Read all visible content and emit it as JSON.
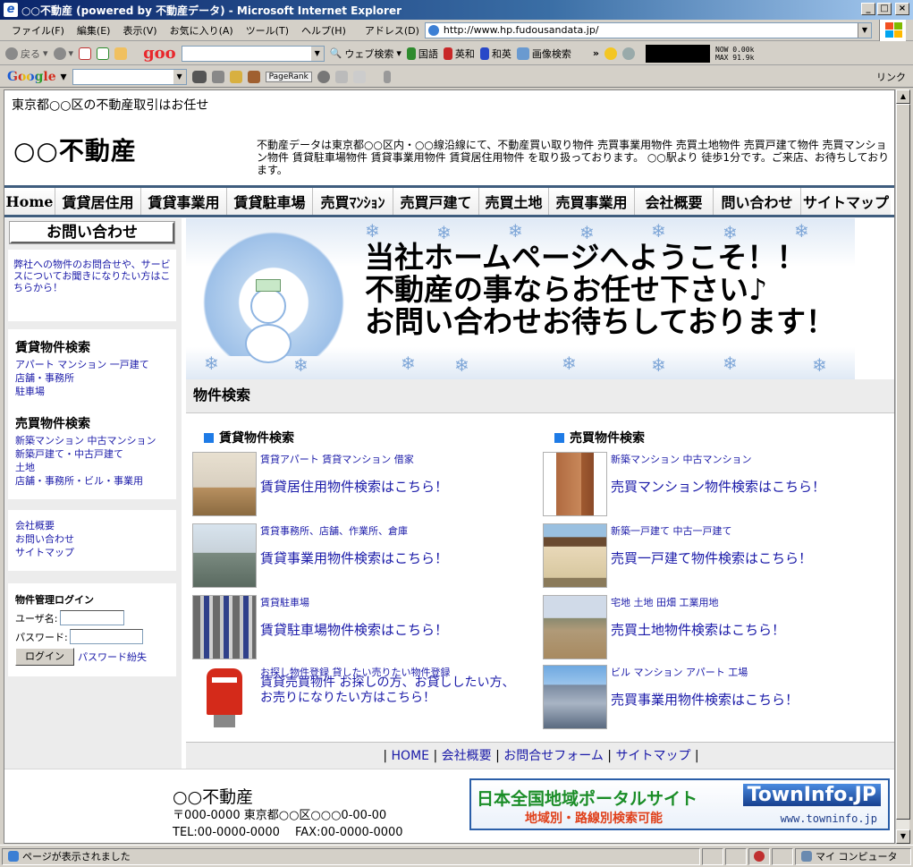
{
  "window": {
    "title": "○○不動産 (powered by 不動産データ) - Microsoft Internet Explorer",
    "minimize": "_",
    "maximize": "□",
    "close": "×"
  },
  "menubar": {
    "items": [
      "ファイル(F)",
      "編集(E)",
      "表示(V)",
      "お気に入り(A)",
      "ツール(T)",
      "ヘルプ(H)"
    ],
    "address_label": "アドレス(D)",
    "address_value": "http://www.hp.fudousandata.jp/"
  },
  "toolbar": {
    "back": "戻る",
    "goo": "goo",
    "web_search": "ウェブ検索",
    "kokugo": "国語",
    "eiwa": "英和",
    "waei": "和英",
    "image_search": "画像検索",
    "now": "NOW",
    "now_val": "0.00k",
    "max": "MAX",
    "max_val": "91.9k"
  },
  "googlebar": {
    "logo": "Google",
    "pagerank": "PageRank",
    "links_label": "リンク"
  },
  "page": {
    "tagline": "東京都○○区の不動産取引はお任せ",
    "company": "○○不動産",
    "description": "不動産データは東京都○○区内・○○線沿線にて、不動産買い取り物件 売買事業用物件 売買土地物件 売買戸建て物件 売買マンション物件 賃貸駐車場物件 賃貸事業用物件 賃貸居住用物件 を取り扱っております。 ○○駅より 徒歩1分です。ご来店、お待ちしております。",
    "nav": [
      "Home",
      "賃貸居住用",
      "賃貸事業用",
      "賃貸駐車場",
      "売買ﾏﾝｼｮﾝ",
      "売買戸建て",
      "売買土地",
      "売買事業用",
      "会社概要",
      "問い合わせ",
      "サイトマップ"
    ],
    "sidebar": {
      "contact_button": "お問い合わせ",
      "contact_note": "弊社への物件のお問合せや、サービスについてお聞きになりたい方はこちらから！",
      "rent_heading": "賃貸物件検索",
      "rent_links": [
        "アパート マンション 一戸建て",
        "店舗・事務所",
        "駐車場"
      ],
      "sale_heading": "売買物件検索",
      "sale_links": [
        "新築マンション 中古マンション",
        "新築戸建て・中古戸建て",
        "土地",
        "店舗・事務所・ビル・事業用"
      ],
      "misc_links": [
        "会社概要",
        "お問い合わせ",
        "サイトマップ"
      ],
      "login_heading": "物件管理ログイン",
      "user_label": "ユーザ名:",
      "pass_label": "パスワード:",
      "login_button": "ログイン",
      "forgot": "パスワード紛失"
    },
    "banner": {
      "line1": "当社ホームページへようこそ！！",
      "line2": "不動産の事ならお任せ下さい♪",
      "line3": "お問い合わせお待ちしております！"
    },
    "search_section_title": "物件検索",
    "rent_column_title": "賃貸物件検索",
    "sale_column_title": "売買物件検索",
    "rent_items": [
      {
        "small": "賃貸アパート 賃貸マンション 借家",
        "big": "賃貸居住用物件検索はこちら！"
      },
      {
        "small": "賃貸事務所、店舗、作業所、倉庫",
        "big": "賃貸事業用物件検索はこちら！"
      },
      {
        "small": "賃貸駐車場",
        "big": "賃貸駐車場物件検索はこちら！"
      },
      {
        "small": "お探し物件登録 貸したい売りたい物件登録",
        "big": "賃貸売買物件 お探しの方、お貸ししたい方、",
        "big2": "お売りになりたい方はこちら！"
      }
    ],
    "sale_items": [
      {
        "small": "新築マンション 中古マンション",
        "big": "売買マンション物件検索はこちら！"
      },
      {
        "small": "新築一戸建て 中古一戸建て",
        "big": "売買一戸建て物件検索はこちら！"
      },
      {
        "small": "宅地 土地 田畑 工業用地",
        "big": "売買土地物件検索はこちら！"
      },
      {
        "small": "ビル マンション アパート 工場",
        "big": "売買事業用物件検索はこちら！"
      }
    ],
    "footer_links": [
      "HOME",
      "会社概要",
      "お問合せフォーム",
      "サイトマップ"
    ],
    "footer": {
      "company": "○○不動産",
      "address": "〒000-0000 東京都○○区○○○0-00-00",
      "tel_fax": "TEL:00-0000-0000　 FAX:00-0000-0000"
    },
    "town_banner": {
      "title": "日本全国地域ポータルサイト",
      "subtitle": "地域別・路線別検索可能",
      "logo": "TownInfo.JP",
      "url": "www.towninfo.jp"
    }
  },
  "status": {
    "message": "ページが表示されました",
    "zone": "マイ コンピュータ"
  }
}
